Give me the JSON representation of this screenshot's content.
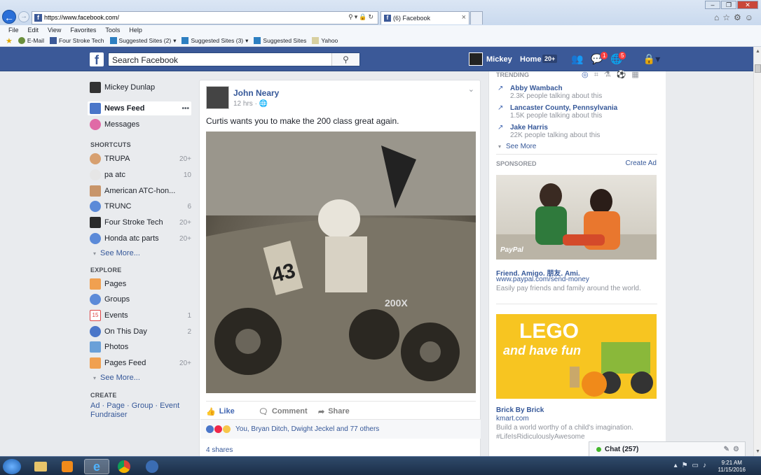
{
  "browser": {
    "url": "https://www.facebook.com/",
    "tab_title": "(6) Facebook",
    "menu": [
      "File",
      "Edit",
      "View",
      "Favorites",
      "Tools",
      "Help"
    ],
    "favorites": [
      "E-Mail",
      "Four Stroke Tech",
      "Suggested Sites (2)",
      "Suggested Sites (3)",
      "Suggested Sites",
      "Yahoo"
    ]
  },
  "header": {
    "search_placeholder": "Search Facebook",
    "user_name": "Mickey",
    "home_label": "Home",
    "home_count": "20+",
    "messages_badge": "1",
    "notifications_badge": "5"
  },
  "left_nav": {
    "profile_name": "Mickey Dunlap",
    "news_feed": "News Feed",
    "news_feed_more": "•••",
    "messages": "Messages",
    "shortcuts_title": "SHORTCUTS",
    "shortcuts": [
      {
        "label": "TRUPA",
        "count": "20+"
      },
      {
        "label": "pa atc",
        "count": "10"
      },
      {
        "label": "American ATC-hon...",
        "count": ""
      },
      {
        "label": "TRUNC",
        "count": "6"
      },
      {
        "label": "Four Stroke Tech",
        "count": "20+"
      },
      {
        "label": "Honda atc parts",
        "count": "20+"
      }
    ],
    "see_more_1": "See More...",
    "explore_title": "EXPLORE",
    "explore": [
      {
        "label": "Pages",
        "count": ""
      },
      {
        "label": "Groups",
        "count": ""
      },
      {
        "label": "Events",
        "count": "1"
      },
      {
        "label": "On This Day",
        "count": "2"
      },
      {
        "label": "Photos",
        "count": ""
      },
      {
        "label": "Pages Feed",
        "count": "20+"
      }
    ],
    "see_more_2": "See More...",
    "create_title": "CREATE",
    "create_links": [
      "Ad",
      "Page",
      "Group",
      "Event",
      "Fundraiser"
    ]
  },
  "post": {
    "author": "John Neary",
    "time": "12 hrs",
    "text": "Curtis wants you to make the 200 class great again.",
    "like": "Like",
    "comment": "Comment",
    "share": "Share",
    "reactions_text": "You, Bryan Ditch, Dwight Jeckel and 77 others",
    "shares": "4 shares",
    "photo_number": "43",
    "photo_label": "200X"
  },
  "right": {
    "trending_title": "TRENDING",
    "trending": [
      {
        "title": "Abby Wambach",
        "sub": "2.3K people talking about this"
      },
      {
        "title": "Lancaster County, Pennsylvania",
        "sub": "1.5K people talking about this"
      },
      {
        "title": "Jake Harris",
        "sub": "22K people talking about this"
      }
    ],
    "see_more": "See More",
    "sponsored_title": "SPONSORED",
    "create_ad": "Create Ad",
    "ad1": {
      "title": "Friend. Amigo. 朋友. Ami.",
      "url": "www.paypal.com/send-money",
      "desc": "Easily pay friends and family around the world.",
      "logo": "PayPal"
    },
    "ad2": {
      "title": "Brick By Brick",
      "url": "kmart.com",
      "desc": "Build a world worthy of a child's imagination.",
      "tag": "#LifeIsRidiculouslyAwesome",
      "img_text_1": "LEGO",
      "img_text_2": "and have fun"
    },
    "chat": "Chat (257)"
  },
  "taskbar": {
    "time": "9:21 AM",
    "date": "11/15/2016"
  },
  "colors": {
    "fb_blue": "#3b5998",
    "link": "#365899",
    "badge": "#fa3e3e"
  }
}
